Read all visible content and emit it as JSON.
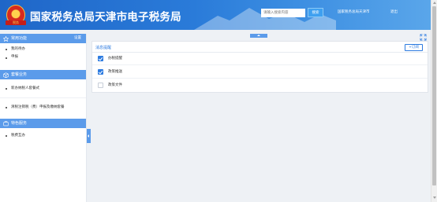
{
  "header": {
    "emblem_text": "税务",
    "title": "国家税务总局天津市电子税务局",
    "search_placeholder": "请输入搜索内容",
    "search_button": "搜索",
    "link_1": "国家税务总局天津市",
    "link_2": "退出"
  },
  "sidebar": {
    "common": {
      "title": "常用功能",
      "setting": "设置",
      "items": [
        {
          "label": "我的待办"
        },
        {
          "label": "申报"
        }
      ]
    },
    "services": {
      "title": "套餐业务",
      "items": [
        {
          "label": "新办纳税人套餐式"
        },
        {
          "label": "清税注销税（费）申报及缴纳套餐"
        }
      ]
    },
    "special": {
      "title": "特色服务",
      "items": [
        {
          "label": "税费互办"
        }
      ]
    }
  },
  "panel": {
    "title": "消息提醒",
    "subscribe_button": "+订阅",
    "options": [
      {
        "label": "办税提醒",
        "checked": true
      },
      {
        "label": "政策推送",
        "checked": true
      },
      {
        "label": "政策文件",
        "checked": false
      }
    ]
  },
  "colors": {
    "header_blue": "#2a7bd9",
    "accent": "#2d7be0",
    "section_header": "#5b9bea"
  }
}
